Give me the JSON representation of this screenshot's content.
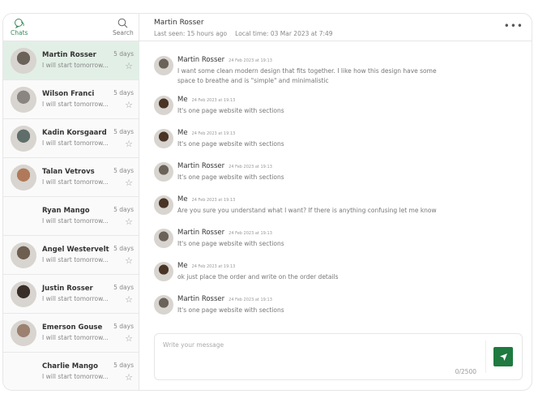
{
  "colors": {
    "accent": "#1e7a3e",
    "selected_row": "#e2efe6"
  },
  "sidebar": {
    "tabs": [
      {
        "label": "Chats",
        "icon": "chat-bubbles-icon"
      },
      {
        "label": "Search",
        "icon": "search-icon"
      }
    ],
    "chats": [
      {
        "name": "Martin Rosser",
        "preview": "I will start tomorrow...",
        "time": "5 days",
        "selected": true,
        "avatar": "#6b6259"
      },
      {
        "name": "Wilson Franci",
        "preview": "I will start tomorrow...",
        "time": "5 days",
        "avatar": "#8a8580"
      },
      {
        "name": "Kadin Korsgaard",
        "preview": "I will start tomorrow...",
        "time": "5 days",
        "avatar": "#5f6e6a"
      },
      {
        "name": "Talan Vetrovs",
        "preview": "I will start tomorrow...",
        "time": "5 days",
        "avatar": "#b07a5a"
      },
      {
        "name": "Ryan Mango",
        "preview": "I will start tomorrow...",
        "time": "5 days",
        "avatar": ""
      },
      {
        "name": "Angel Westervelt",
        "preview": "I will start tomorrow...",
        "time": "5 days",
        "avatar": "#6e5e50"
      },
      {
        "name": "Justin Rosser",
        "preview": "I will start tomorrow...",
        "time": "5 days",
        "avatar": "#3a2e28"
      },
      {
        "name": "Emerson Gouse",
        "preview": "I will start tomorrow...",
        "time": "5 days",
        "avatar": "#9c8070"
      },
      {
        "name": "Charlie Mango",
        "preview": "I will start tomorrow...",
        "time": "5 days",
        "avatar": ""
      }
    ]
  },
  "header": {
    "name": "Martin Rosser",
    "last_seen": "Last seen: 15 hours ago",
    "local_time": "Local time: 03 Mar 2023 at 7:49",
    "menu_icon": "more-horizontal-icon"
  },
  "messages": [
    {
      "sender": "Martin Rosser",
      "date": "24 Feb 2023 at 19:13",
      "text": "I want some clean modern design that fits together. I like how this design have some space to breathe and is \"simple\" and minimalistic",
      "avatar": "#6b6259"
    },
    {
      "sender": "Me",
      "date": "24 Feb 2023 at 19:13",
      "text": "It's one page website with sections",
      "avatar": "#4a3426"
    },
    {
      "sender": "Me",
      "date": "24 Feb 2023 at 19:13",
      "text": "It's one page website with sections",
      "avatar": "#4a3426"
    },
    {
      "sender": "Martin Rosser",
      "date": "24 Feb 2023 at 19:13",
      "text": "It's one page website with sections",
      "avatar": "#6b6259"
    },
    {
      "sender": "Me",
      "date": "24 Feb 2023 at 19:13",
      "text": "Are you sure you understand what I want? If there is anything confusing let me know",
      "avatar": "#4a3426"
    },
    {
      "sender": "Martin Rosser",
      "date": "24 Feb 2023 at 19:13",
      "text": "It's one page website with sections",
      "avatar": "#6b6259"
    },
    {
      "sender": "Me",
      "date": "24 Feb 2023 at 19:13",
      "text": "ok just place the order and write on the order details",
      "avatar": "#4a3426"
    },
    {
      "sender": "Martin Rosser",
      "date": "24 Feb 2023 at 19:13",
      "text": "It's one page website with sections",
      "avatar": "#6b6259"
    }
  ],
  "composer": {
    "placeholder": "Write your message",
    "counter": "0/2500",
    "send_icon": "send-icon"
  }
}
